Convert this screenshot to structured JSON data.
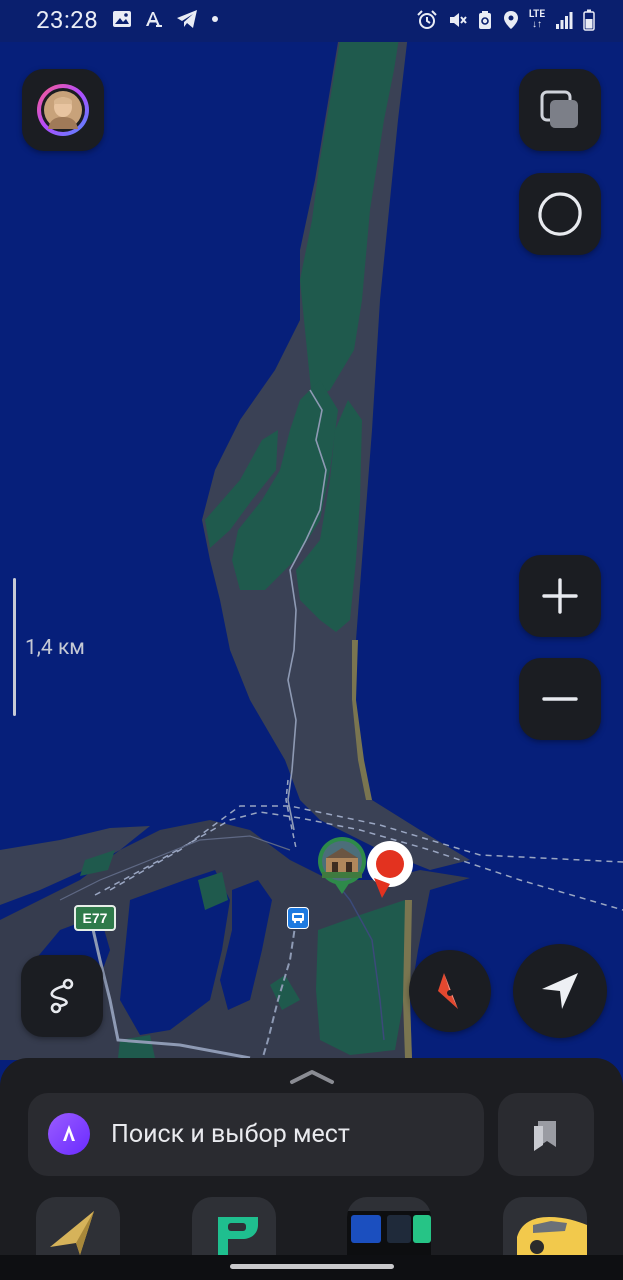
{
  "status_bar": {
    "time": "23:28",
    "lte_top": "LTE",
    "lte_bottom": "↓↑",
    "left_icons": [
      "image-icon",
      "translate-icon",
      "telegram-icon",
      "dot-icon"
    ],
    "right_icons": [
      "alarm-icon",
      "mute-icon",
      "battery-saver-icon",
      "location-icon",
      "lte-icon",
      "signal-icon",
      "battery-icon"
    ]
  },
  "map": {
    "scale_label": "1,4 км",
    "road_badge": "E77",
    "colors": {
      "water": "#061f7a",
      "land": "#3b4254",
      "forest": "#1f5b4e",
      "road": "#8e9ab4",
      "pin": "#e3321f"
    }
  },
  "controls": {
    "left_top": "avatar",
    "right_top": [
      "layers-icon",
      "alice-ring-icon"
    ],
    "zoom_in": "+",
    "zoom_out": "−",
    "route_icon": "route-icon",
    "compass_icon": "compass-icon",
    "locate_icon": "locate-arrow-icon"
  },
  "bottom_sheet": {
    "search_placeholder": "Поиск и выбор мест",
    "bookmarks_icon": "bookmarks-icon",
    "apps": [
      "navigator-app",
      "parking-app",
      "transport-app",
      "taxi-app"
    ]
  }
}
